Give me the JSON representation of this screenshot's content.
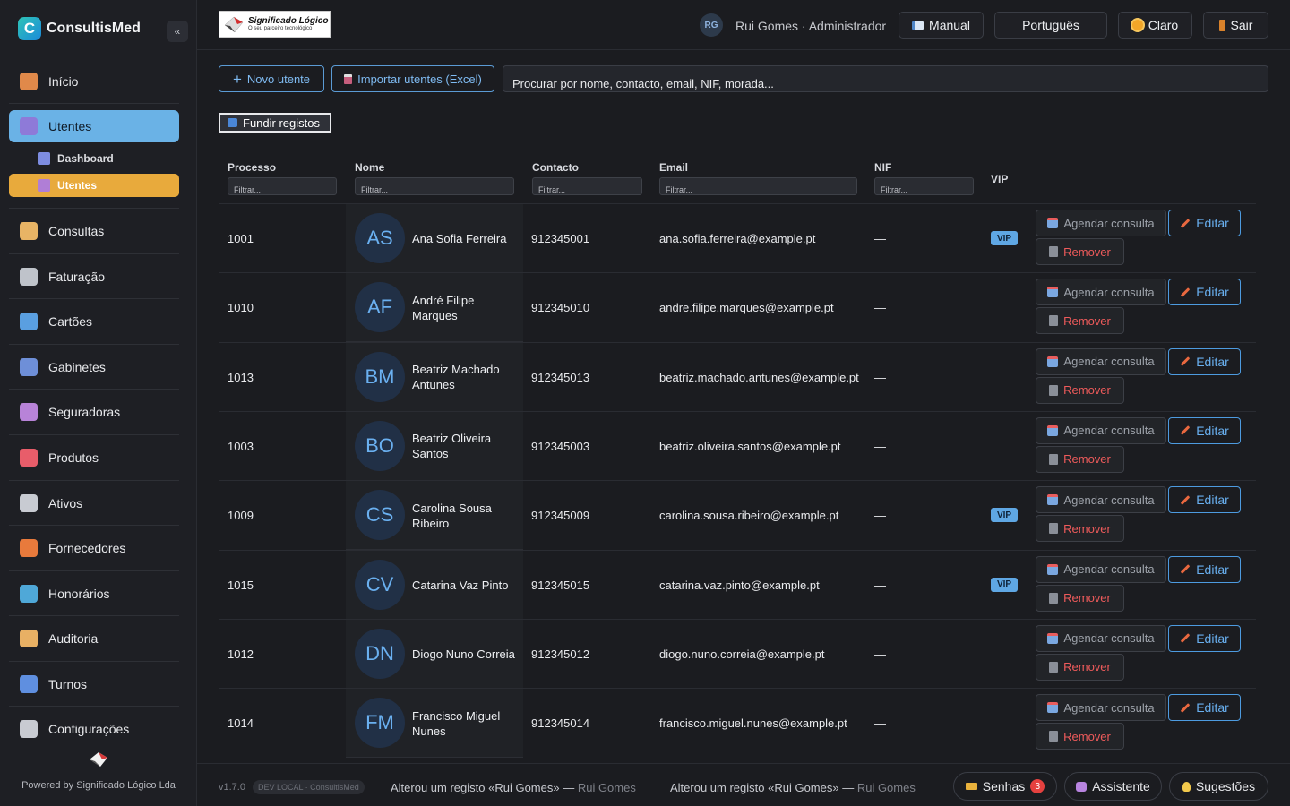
{
  "app": {
    "name": "ConsultisMed",
    "logo_letter": "C"
  },
  "sidebar": {
    "items": [
      {
        "label": "Início",
        "icon": "home-icon",
        "color": "#e0894a"
      },
      {
        "label": "Utentes",
        "icon": "patients-icon",
        "color": "#8e7ad8"
      },
      {
        "label": "Consultas",
        "icon": "doctor-icon",
        "color": "#e8b465"
      },
      {
        "label": "Faturação",
        "icon": "invoice-icon",
        "color": "#bfc3ca"
      },
      {
        "label": "Cartões",
        "icon": "card-icon",
        "color": "#5a9fe0"
      },
      {
        "label": "Gabinetes",
        "icon": "calendar-icon",
        "color": "#6e8fd8"
      },
      {
        "label": "Seguradoras",
        "icon": "insurance-icon",
        "color": "#b883d8"
      },
      {
        "label": "Produtos",
        "icon": "pill-icon",
        "color": "#e85d6a"
      },
      {
        "label": "Ativos",
        "icon": "tools-icon",
        "color": "#c8cbd2"
      },
      {
        "label": "Fornecedores",
        "icon": "truck-icon",
        "color": "#e87a3c"
      },
      {
        "label": "Honorários",
        "icon": "money-icon",
        "color": "#4fa8d8"
      },
      {
        "label": "Auditoria",
        "icon": "scroll-icon",
        "color": "#e8b064"
      },
      {
        "label": "Turnos",
        "icon": "schedule-icon",
        "color": "#5f8fe0"
      },
      {
        "label": "Configurações",
        "icon": "gear-icon",
        "color": "#c8cbd2"
      }
    ],
    "subitems": [
      {
        "label": "Dashboard",
        "icon": "chart-icon"
      },
      {
        "label": "Utentes",
        "icon": "patients-icon"
      }
    ],
    "powered": "Powered by Significado Lógico Lda"
  },
  "topbar": {
    "logo_title": "Significado Lógico",
    "logo_sub": "O seu parceiro tecnológico",
    "user_initials": "RG",
    "user_label": "Rui Gomes · Administrador",
    "manual": "Manual",
    "language": "Português",
    "theme": "Claro",
    "logout": "Sair"
  },
  "actions": {
    "new_patient": "Novo utente",
    "import": "Importar utentes (Excel)",
    "search_placeholder": "Procurar por nome, contacto, email, NIF, morada...",
    "merge": "Fundir registos"
  },
  "table": {
    "headers": {
      "process": "Processo",
      "name": "Nome",
      "contact": "Contacto",
      "email": "Email",
      "nif": "NIF",
      "vip": "VIP"
    },
    "filter_placeholder": "Filtrar...",
    "vip_label": "VIP",
    "schedule_label": "Agendar consulta",
    "edit_label": "Editar",
    "remove_label": "Remover",
    "rows": [
      {
        "process": "1001",
        "initials": "AS",
        "name": "Ana Sofia Ferreira",
        "contact": "912345001",
        "email": "ana.sofia.ferreira@example.pt",
        "nif": "—",
        "vip": true
      },
      {
        "process": "1010",
        "initials": "AF",
        "name": "André Filipe Marques",
        "contact": "912345010",
        "email": "andre.filipe.marques@example.pt",
        "nif": "—",
        "vip": false
      },
      {
        "process": "1013",
        "initials": "BM",
        "name": "Beatriz Machado Antunes",
        "contact": "912345013",
        "email": "beatriz.machado.antunes@example.pt",
        "nif": "—",
        "vip": false
      },
      {
        "process": "1003",
        "initials": "BO",
        "name": "Beatriz Oliveira Santos",
        "contact": "912345003",
        "email": "beatriz.oliveira.santos@example.pt",
        "nif": "—",
        "vip": false
      },
      {
        "process": "1009",
        "initials": "CS",
        "name": "Carolina Sousa Ribeiro",
        "contact": "912345009",
        "email": "carolina.sousa.ribeiro@example.pt",
        "nif": "—",
        "vip": true
      },
      {
        "process": "1015",
        "initials": "CV",
        "name": "Catarina Vaz Pinto",
        "contact": "912345015",
        "email": "catarina.vaz.pinto@example.pt",
        "nif": "—",
        "vip": true
      },
      {
        "process": "1012",
        "initials": "DN",
        "name": "Diogo Nuno Correia",
        "contact": "912345012",
        "email": "diogo.nuno.correia@example.pt",
        "nif": "—",
        "vip": false
      },
      {
        "process": "1014",
        "initials": "FM",
        "name": "Francisco Miguel Nunes",
        "contact": "912345014",
        "email": "francisco.miguel.nunes@example.pt",
        "nif": "—",
        "vip": false
      }
    ]
  },
  "footer": {
    "version": "v1.7.0",
    "env": "DEV LOCAL · ConsultisMed",
    "logs": [
      {
        "text": "Alterou um registo «Rui Gomes» —",
        "who": "Rui Gomes"
      },
      {
        "text": "Alterou um registo «Rui Gomes» —",
        "who": "Rui Gomes"
      }
    ],
    "senhas": "Senhas",
    "senhas_count": "3",
    "assistant": "Assistente",
    "suggestions": "Sugestões"
  }
}
